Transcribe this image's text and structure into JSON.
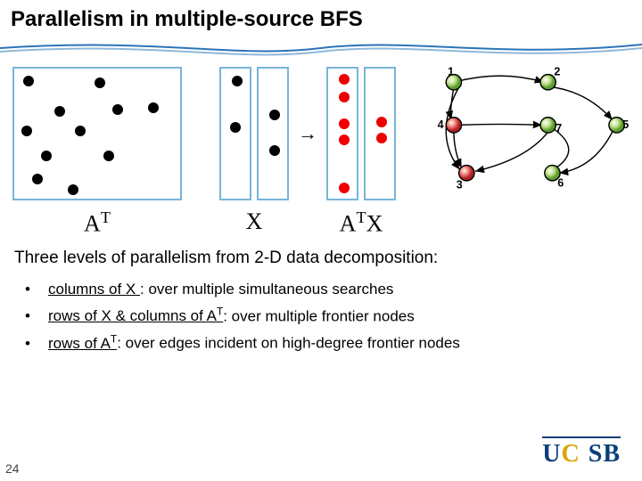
{
  "title": "Parallelism in multiple-source BFS",
  "arrow": "→",
  "labels": {
    "AT": "A",
    "AT_sup": "T",
    "X": "X",
    "ATX": "A",
    "ATX_sup": "T",
    "ATX_tail": "X"
  },
  "body": "Three levels of parallelism from 2-D data decomposition:",
  "bullets": {
    "b1_u": "columns of X ",
    "b1_rest": ":   over multiple simultaneous searches",
    "b2_u": "rows of X & columns of A",
    "b2_sup": "T",
    "b2_rest": ":    over multiple frontier nodes",
    "b3_u": "rows of A",
    "b3_sup": "T",
    "b3_rest": ":    over edges incident on high-degree frontier nodes"
  },
  "graph": {
    "nodes": {
      "n1": "1",
      "n2": "2",
      "n3": "3",
      "n4": "4",
      "n5": "5",
      "n6": "6",
      "n7": "7"
    }
  },
  "slide_num": "24",
  "logo": {
    "u1": "U",
    "c": "C",
    "s": "S",
    "b": "B"
  }
}
